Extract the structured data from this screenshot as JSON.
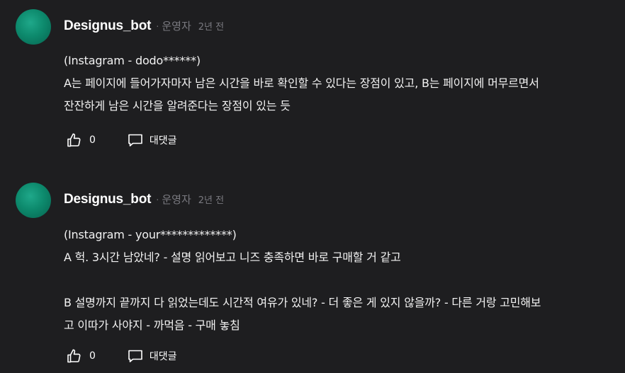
{
  "comments": [
    {
      "author": "Designus_bot",
      "separator": "·",
      "role": "운영자",
      "time": "2년 전",
      "lines": [
        "(Instagram - dodo******)",
        "A는 페이지에 들어가자마자 남은 시간을 바로 확인할 수 있다는 장점이 있고, B는 페이지에 머무르면서",
        "잔잔하게 남은 시간을 알려준다는 장점이 있는 듯"
      ],
      "likes": "0",
      "like_icon": "thumbs-up-icon",
      "reply_label": "대댓글",
      "reply_icon": "speech-bubble-icon"
    },
    {
      "author": "Designus_bot",
      "separator": "·",
      "role": "운영자",
      "time": "2년 전",
      "lines": [
        "(Instagram - your*************)",
        "A 헉. 3시간 남았네? - 설명 읽어보고 니즈 충족하면 바로 구매할 거 같고",
        "",
        "B 설명까지 끝까지 다 읽었는데도 시간적 여유가 있네? - 더 좋은 게 있지 않을까? - 다른 거랑 고민해보",
        "고 이따가 사야지 - 까먹음 - 구매 놓침"
      ],
      "likes": "0",
      "like_icon": "thumbs-up-icon",
      "reply_label": "대댓글",
      "reply_icon": "speech-bubble-icon"
    }
  ],
  "colors": {
    "background": "#1e1e20",
    "avatar": "#0d8a6d",
    "meta_text": "#7a7a80"
  }
}
